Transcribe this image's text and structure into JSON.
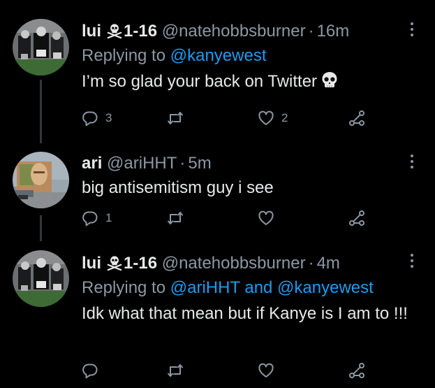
{
  "tweets": [
    {
      "display_name": "lui",
      "badge": "1-16",
      "handle": "@natehobbsburner",
      "time": "16m",
      "reply_prefix": "Replying to ",
      "reply_mentions": "@kanyewest",
      "text": "I’m so glad your back on Twitter",
      "emoji": "skull-emoji",
      "counts": {
        "reply": "3",
        "retweet": "",
        "like": "2"
      }
    },
    {
      "display_name": "ari",
      "handle": "@ariHHT",
      "time": "5m",
      "text": "big antisemitism guy i see",
      "counts": {
        "reply": "1",
        "retweet": "",
        "like": ""
      }
    },
    {
      "display_name": "lui",
      "badge": "1-16",
      "handle": "@natehobbsburner",
      "time": "4m",
      "reply_prefix": "Replying to ",
      "reply_mentions": "@ariHHT and @kanyewest",
      "text": "Idk what that mean but if Kanye is I am to !!!",
      "counts": {
        "reply": "",
        "retweet": "",
        "like": ""
      }
    }
  ],
  "separator": "·",
  "colors": {
    "background": "#000000",
    "text": "#e7e9ea",
    "secondary": "#8b98a5",
    "link": "#1d9bf0",
    "thread_line": "#333639"
  },
  "icons": [
    "reply-icon",
    "retweet-icon",
    "like-icon",
    "share-icon",
    "more-icon",
    "skull-crossbones-icon"
  ]
}
